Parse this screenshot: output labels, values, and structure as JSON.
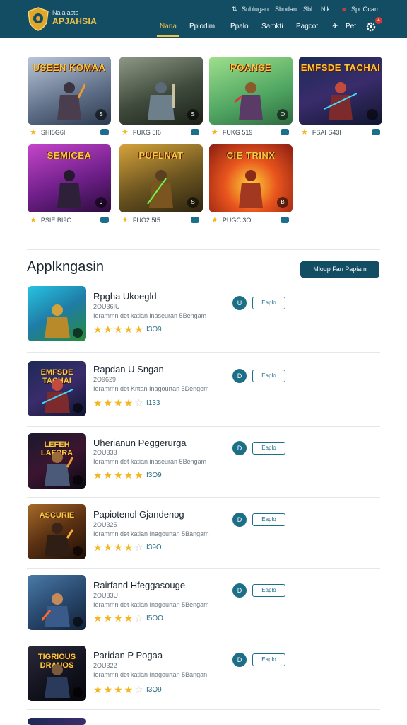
{
  "header": {
    "brand_line1": "Nalalasts",
    "brand_line2": "APJAHSIA",
    "top_links": [
      "Sublugan",
      "Sbodan",
      "Sbl",
      "Nlk"
    ],
    "account": "Spr Ocam",
    "nav": [
      "Nana",
      "Pplodim",
      "Ppalo",
      "Samkti",
      "Pagcot",
      "Pet"
    ],
    "active_nav": "Nana",
    "notification_count": "4",
    "accent": "#f1c14b",
    "bar_color": "#124d63"
  },
  "games": [
    {
      "title": "USEEN KOMAA",
      "meta": "SHI5G6I",
      "corner": "S"
    },
    {
      "title": "",
      "meta": "FUKG 5I6",
      "corner": "S"
    },
    {
      "title": "POANSE",
      "meta": "FUKG 519",
      "corner": "O"
    },
    {
      "title": "EMFSDE TACHAI",
      "meta": "FSAI S43I",
      "corner": ""
    },
    {
      "title": "SEMICEA",
      "meta": "PSIE BI9O",
      "corner": "9"
    },
    {
      "title": "PUFLNAT",
      "meta": "FUO2:5I5",
      "corner": "S"
    },
    {
      "title": "CIE TRINX",
      "meta": "PUGC:3O",
      "corner": "B"
    }
  ],
  "section": {
    "title": "Applkngasin",
    "button": "Mloup Fan Papiam"
  },
  "apps": [
    {
      "name": "Rpgha Ukoegld",
      "sub": "2OU36IU",
      "desc": "Iorammn det katian inaseuran 5Bengam",
      "stars": 5,
      "rating": "I3O9",
      "circle": "U",
      "btn": "Eaplo",
      "thumb_title": "",
      "palette": "blue"
    },
    {
      "name": "Rapdan U Sngan",
      "sub": "2O9629",
      "desc": "Iorammn det Kntan Inagourtan 5Dengom",
      "stars": 4,
      "rating": "I133",
      "circle": "D",
      "btn": "Eaplo",
      "thumb_title": "EMFSDE TACHAI",
      "palette": "purple"
    },
    {
      "name": "Uherianun Peggerurga",
      "sub": "2OU333",
      "desc": "Iorammn det katian inaseuran 5Bengam",
      "stars": 5,
      "rating": "I3O9",
      "circle": "D",
      "btn": "Eaplo",
      "thumb_title": "LEFEH LAFRRA",
      "palette": "dark"
    },
    {
      "name": "Papiotenol Gjandenog",
      "sub": "2OU325",
      "desc": "Iorammn det katian Inagourtan 5Bangam",
      "stars": 4,
      "rating": "I39O",
      "circle": "D",
      "btn": "Eaplo",
      "thumb_title": "ASCURIE",
      "palette": "orange"
    },
    {
      "name": "Rairfand Hfeggasouge",
      "sub": "2OU33U",
      "desc": "Iorammn det katian Inagourtan 5Bengam",
      "stars": 4,
      "rating": "I5OO",
      "circle": "D",
      "btn": "Eaplo",
      "thumb_title": "",
      "palette": "steel"
    },
    {
      "name": "Paridan P Pogaa",
      "sub": "2OU322",
      "desc": "Iorammn det katian Inagourtan 5Bangan",
      "stars": 4,
      "rating": "I3O9",
      "circle": "D",
      "btn": "Eaplo",
      "thumb_title": "TIGRIOUS DRAUOS",
      "palette": "night"
    }
  ]
}
